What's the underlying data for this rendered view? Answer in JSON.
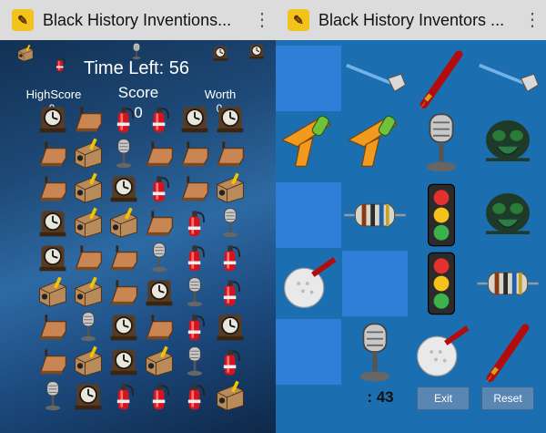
{
  "left_app": {
    "title": "Black History Inventions...",
    "time_label": "Time Left: 56",
    "highscore_label": "HighScore",
    "highscore_value": "0",
    "score_label": "Score",
    "score_value": "0",
    "worth_label": "Worth",
    "worth_value": "0"
  },
  "right_app": {
    "title": "Black History Inventors ...",
    "timer": ": 43",
    "exit_label": "Exit",
    "reset_label": "Reset"
  },
  "left_grid": [
    [
      "clock",
      "dustpan",
      "extinguisher",
      "extinguisher",
      "clock",
      "clock"
    ],
    [
      "dustpan",
      "sharpener",
      "microphone",
      "dustpan",
      "dustpan",
      "dustpan"
    ],
    [
      "dustpan",
      "sharpener",
      "clock",
      "extinguisher",
      "dustpan",
      "sharpener"
    ],
    [
      "clock",
      "sharpener",
      "sharpener",
      "dustpan",
      "extinguisher",
      "microphone"
    ],
    [
      "clock",
      "dustpan",
      "dustpan",
      "microphone",
      "extinguisher",
      "extinguisher"
    ],
    [
      "sharpener",
      "sharpener",
      "dustpan",
      "clock",
      "microphone",
      "extinguisher"
    ],
    [
      "dustpan",
      "microphone",
      "clock",
      "dustpan",
      "extinguisher",
      "clock"
    ],
    [
      "dustpan",
      "sharpener",
      "clock",
      "sharpener",
      "microphone",
      "extinguisher"
    ],
    [
      "microphone",
      "clock",
      "extinguisher",
      "extinguisher",
      "extinguisher",
      "sharpener"
    ]
  ],
  "left_falling": [
    "sharpener",
    "extinguisher",
    "microphone",
    "clock",
    "clock"
  ],
  "right_grid": [
    [
      "blank",
      "wand",
      "pen",
      "wand"
    ],
    [
      "watergun",
      "watergun",
      "microphone",
      "gasmask"
    ],
    [
      "blank",
      "resistor",
      "trafficlight",
      "gasmask"
    ],
    [
      "golfball",
      "blank",
      "trafficlight",
      "resistor"
    ],
    [
      "blank",
      "microphone",
      "golfball",
      "pen"
    ]
  ]
}
